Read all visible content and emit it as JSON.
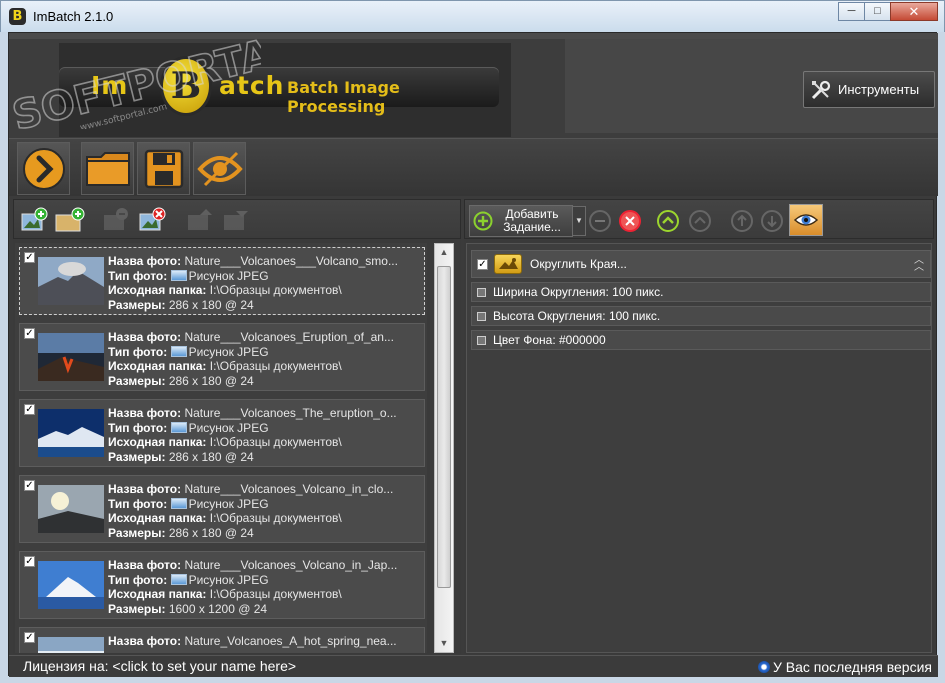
{
  "window": {
    "title": "ImBatch 2.1.0",
    "icon_letter": "B",
    "minimize": "─",
    "maximize": "□",
    "close": "✕"
  },
  "header": {
    "logo_left": "Im",
    "logo_b": "B",
    "logo_right": "atch",
    "logo_subtitle": "Batch Image Processing",
    "watermark": "SOFTPORTAL",
    "watermark_url": "www.softportal.com",
    "tools_label": "Инструменты"
  },
  "bigbar": {
    "buttons": [
      "run",
      "open-folder",
      "save",
      "preview"
    ]
  },
  "image_list": {
    "labels": {
      "name": "Назва фото:",
      "type": "Тип фото:",
      "folder": "Исходная папка:",
      "size": "Размеры:"
    },
    "items": [
      {
        "name": "Nature___Volcanoes___Volcano_smo...",
        "type": "Рисунок JPEG",
        "folder": "I:\\Образцы документов\\",
        "size": "286 x 180 @ 24",
        "checked": true,
        "selected": true
      },
      {
        "name": "Nature___Volcanoes_Eruption_of_an...",
        "type": "Рисунок JPEG",
        "folder": "I:\\Образцы документов\\",
        "size": "286 x 180 @ 24",
        "checked": true,
        "selected": false
      },
      {
        "name": "Nature___Volcanoes_The_eruption_o...",
        "type": "Рисунок JPEG",
        "folder": "I:\\Образцы документов\\",
        "size": "286 x 180 @ 24",
        "checked": true,
        "selected": false
      },
      {
        "name": "Nature___Volcanoes_Volcano_in_clo...",
        "type": "Рисунок JPEG",
        "folder": "I:\\Образцы документов\\",
        "size": "286 x 180 @ 24",
        "checked": true,
        "selected": false
      },
      {
        "name": "Nature___Volcanoes_Volcano_in_Jap...",
        "type": "Рисунок JPEG",
        "folder": "I:\\Образцы документов\\",
        "size": "1600 x 1200 @ 24",
        "checked": true,
        "selected": false
      },
      {
        "name": "Nature_Volcanoes_A_hot_spring_nea...",
        "type": "",
        "folder": "",
        "size": "",
        "checked": true,
        "selected": false
      }
    ]
  },
  "tasks": {
    "add_task_label": "Добавить Задание...",
    "task": {
      "title": "Округлить Края...",
      "checked": true
    },
    "properties": [
      "Ширина Округления: 100 пикс.",
      "Высота Округления: 100 пикс.",
      "Цвет Фона: #000000"
    ]
  },
  "status": {
    "license": "Лицензия на: <click to set your name here>",
    "version": "У Вас последняя версия"
  },
  "colors": {
    "accent": "#e4bd19",
    "background": "#3b3b3b",
    "panel": "#4b4b4b"
  }
}
